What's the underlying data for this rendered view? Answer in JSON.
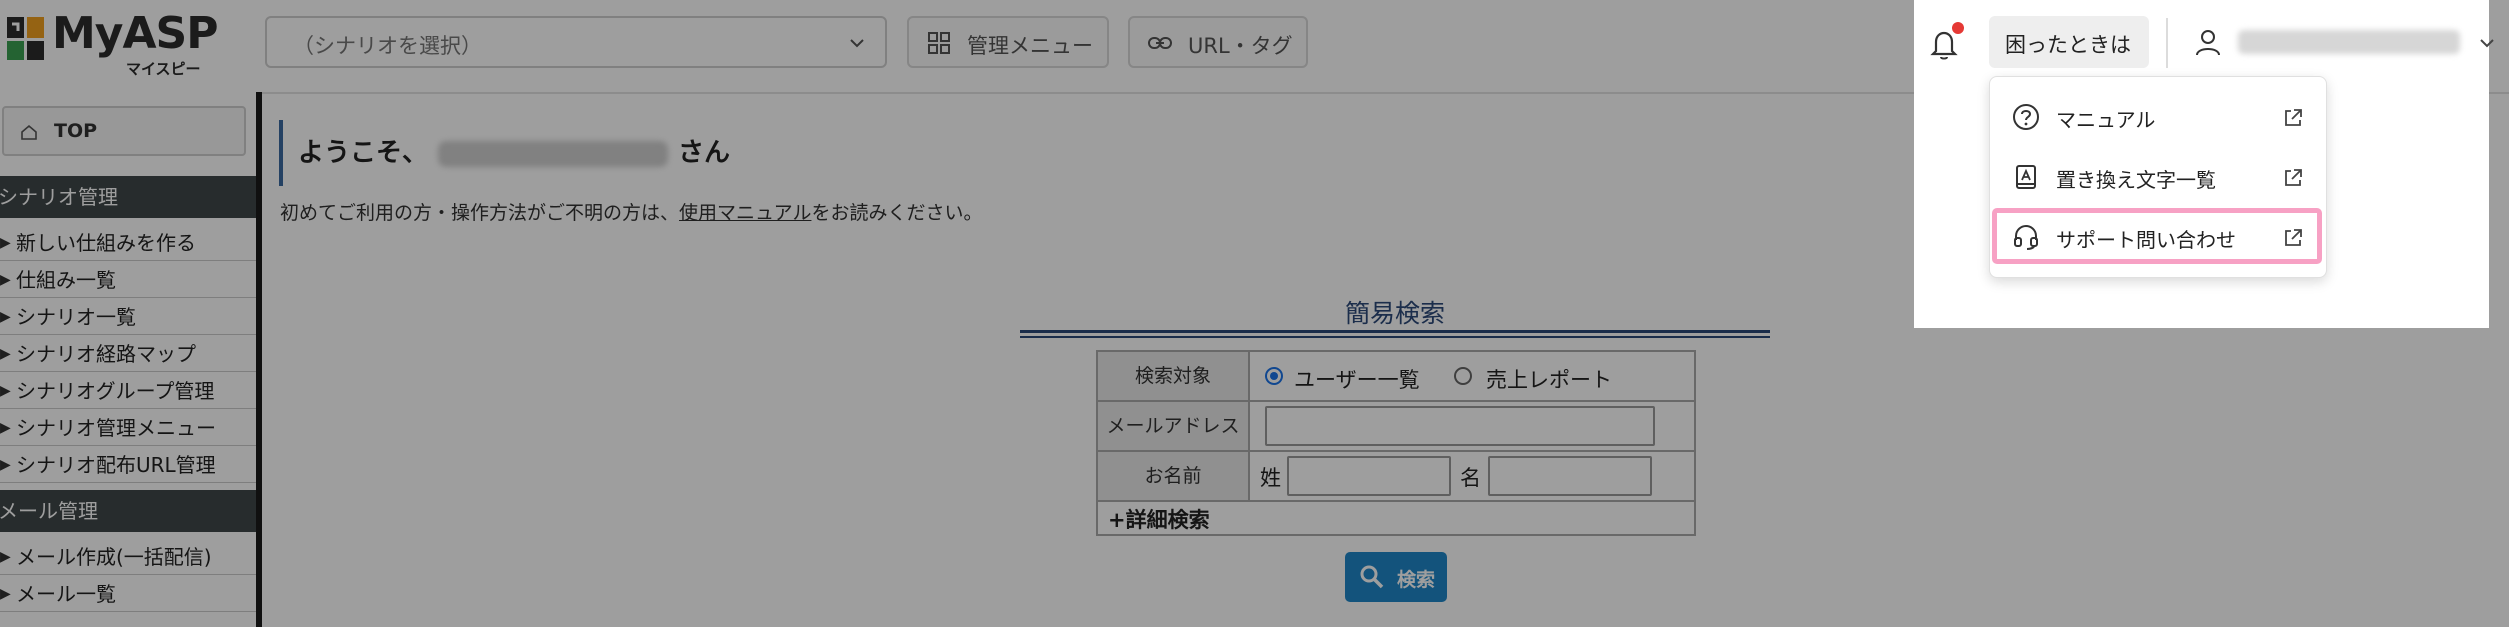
{
  "header": {
    "logo_text": "MyASP",
    "logo_sub": "マイスピー",
    "scenario_placeholder": "（シナリオを選択）",
    "admin_menu_label": "管理メニュー",
    "url_tag_label": "URL・タグ",
    "help_label": "困ったときは"
  },
  "sidebar": {
    "top_label": "TOP",
    "sections": [
      {
        "title": "シナリオ管理",
        "items": [
          "新しい仕組みを作る",
          "仕組み一覧",
          "シナリオ一覧",
          "シナリオ経路マップ",
          "シナリオグループ管理",
          "シナリオ管理メニュー",
          "シナリオ配布URL管理"
        ]
      },
      {
        "title": "メール管理",
        "items": [
          "メール作成(一括配信)",
          "メール一覧"
        ]
      }
    ]
  },
  "main": {
    "welcome_prefix": "ようこそ、",
    "welcome_suffix": "さん",
    "intro_before": "初めてご利用の方・操作方法がご不明の方は、",
    "intro_link": "使用マニュアル",
    "intro_after": "をお読みください。",
    "quick_search_title": "簡易検索",
    "search_target_label": "検索対象",
    "radio_user_list": "ユーザー一覧",
    "radio_sales_report": "売上レポート",
    "email_label": "メールアドレス",
    "name_label": "お名前",
    "last_name_label": "姓",
    "first_name_label": "名",
    "detail_search": "+詳細検索",
    "search_button": "検索"
  },
  "help_menu": {
    "items": [
      "マニュアル",
      "置き換え文字一覧",
      "サポート問い合わせ"
    ]
  },
  "colors": {
    "accent_blue": "#1f86c9",
    "sidebar_header": "#3f4749",
    "highlight_pink": "#f7a1c4",
    "notification_dot": "#e53935"
  }
}
